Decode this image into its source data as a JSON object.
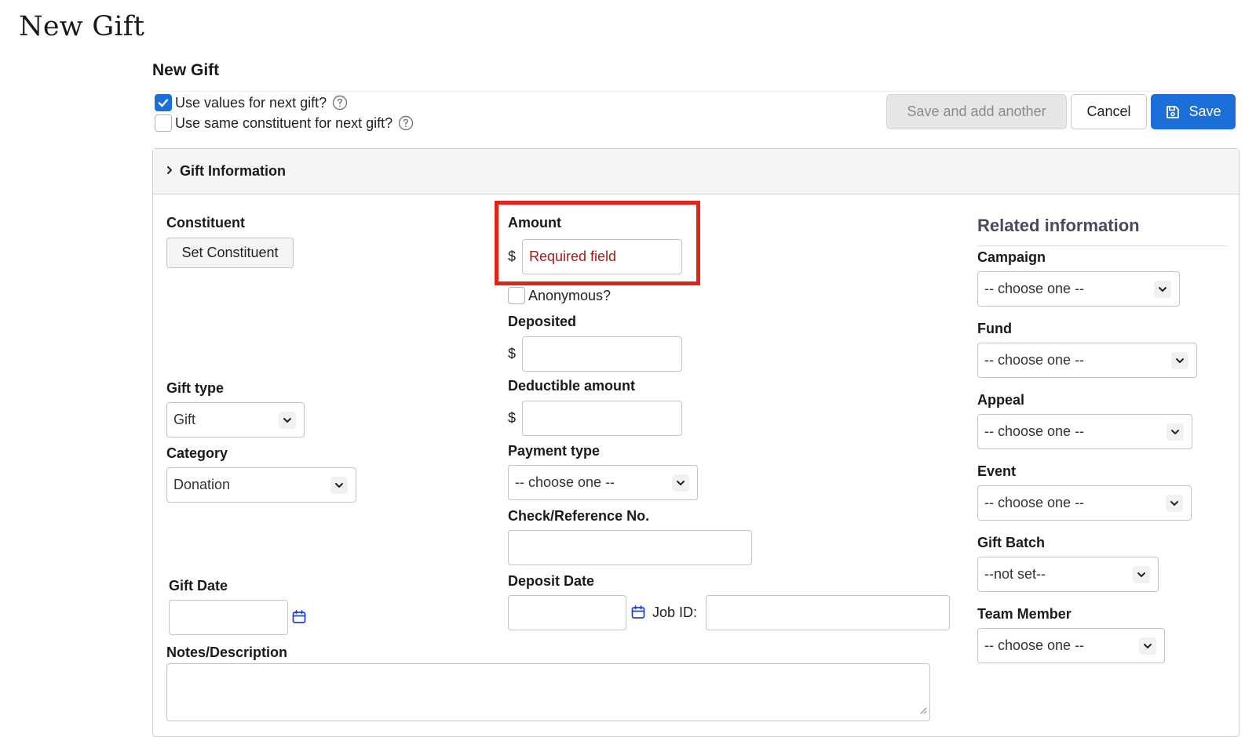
{
  "page": {
    "title": "New Gift"
  },
  "form": {
    "heading": "New Gift",
    "options": {
      "use_values_label": "Use values for next gift?",
      "use_values_checked": true,
      "same_constituent_label": "Use same constituent for next gift?",
      "same_constituent_checked": false
    },
    "buttons": {
      "save_and_add": "Save and add another",
      "cancel": "Cancel",
      "save": "Save"
    }
  },
  "section": {
    "title": "Gift Information"
  },
  "fields": {
    "constituent": {
      "label": "Constituent",
      "button": "Set Constituent"
    },
    "gift_type": {
      "label": "Gift type",
      "value": "Gift"
    },
    "category": {
      "label": "Category",
      "value": "Donation"
    },
    "gift_date": {
      "label": "Gift Date",
      "value": ""
    },
    "notes": {
      "label": "Notes/Description",
      "value": ""
    },
    "amount": {
      "label": "Amount",
      "currency": "$",
      "placeholder": "Required field"
    },
    "anonymous": {
      "label": "Anonymous?",
      "checked": false
    },
    "deposited": {
      "label": "Deposited",
      "currency": "$",
      "value": ""
    },
    "deductible": {
      "label": "Deductible amount",
      "currency": "$",
      "value": ""
    },
    "payment_type": {
      "label": "Payment type",
      "value": "-- choose one --"
    },
    "check_ref": {
      "label": "Check/Reference No.",
      "value": ""
    },
    "deposit_date": {
      "label": "Deposit Date",
      "value": ""
    },
    "job_id": {
      "label": "Job ID:",
      "value": ""
    }
  },
  "related": {
    "title": "Related information",
    "campaign": {
      "label": "Campaign",
      "value": "-- choose one --"
    },
    "fund": {
      "label": "Fund",
      "value": "-- choose one --"
    },
    "appeal": {
      "label": "Appeal",
      "value": "-- choose one --"
    },
    "event": {
      "label": "Event",
      "value": "-- choose one --"
    },
    "gift_batch": {
      "label": "Gift Batch",
      "value": "--not set--"
    },
    "team_member": {
      "label": "Team Member",
      "value": "-- choose one --"
    }
  },
  "colors": {
    "primary": "#1c6ed8",
    "error_highlight": "#e0241c",
    "error_text": "#a01d1d"
  }
}
